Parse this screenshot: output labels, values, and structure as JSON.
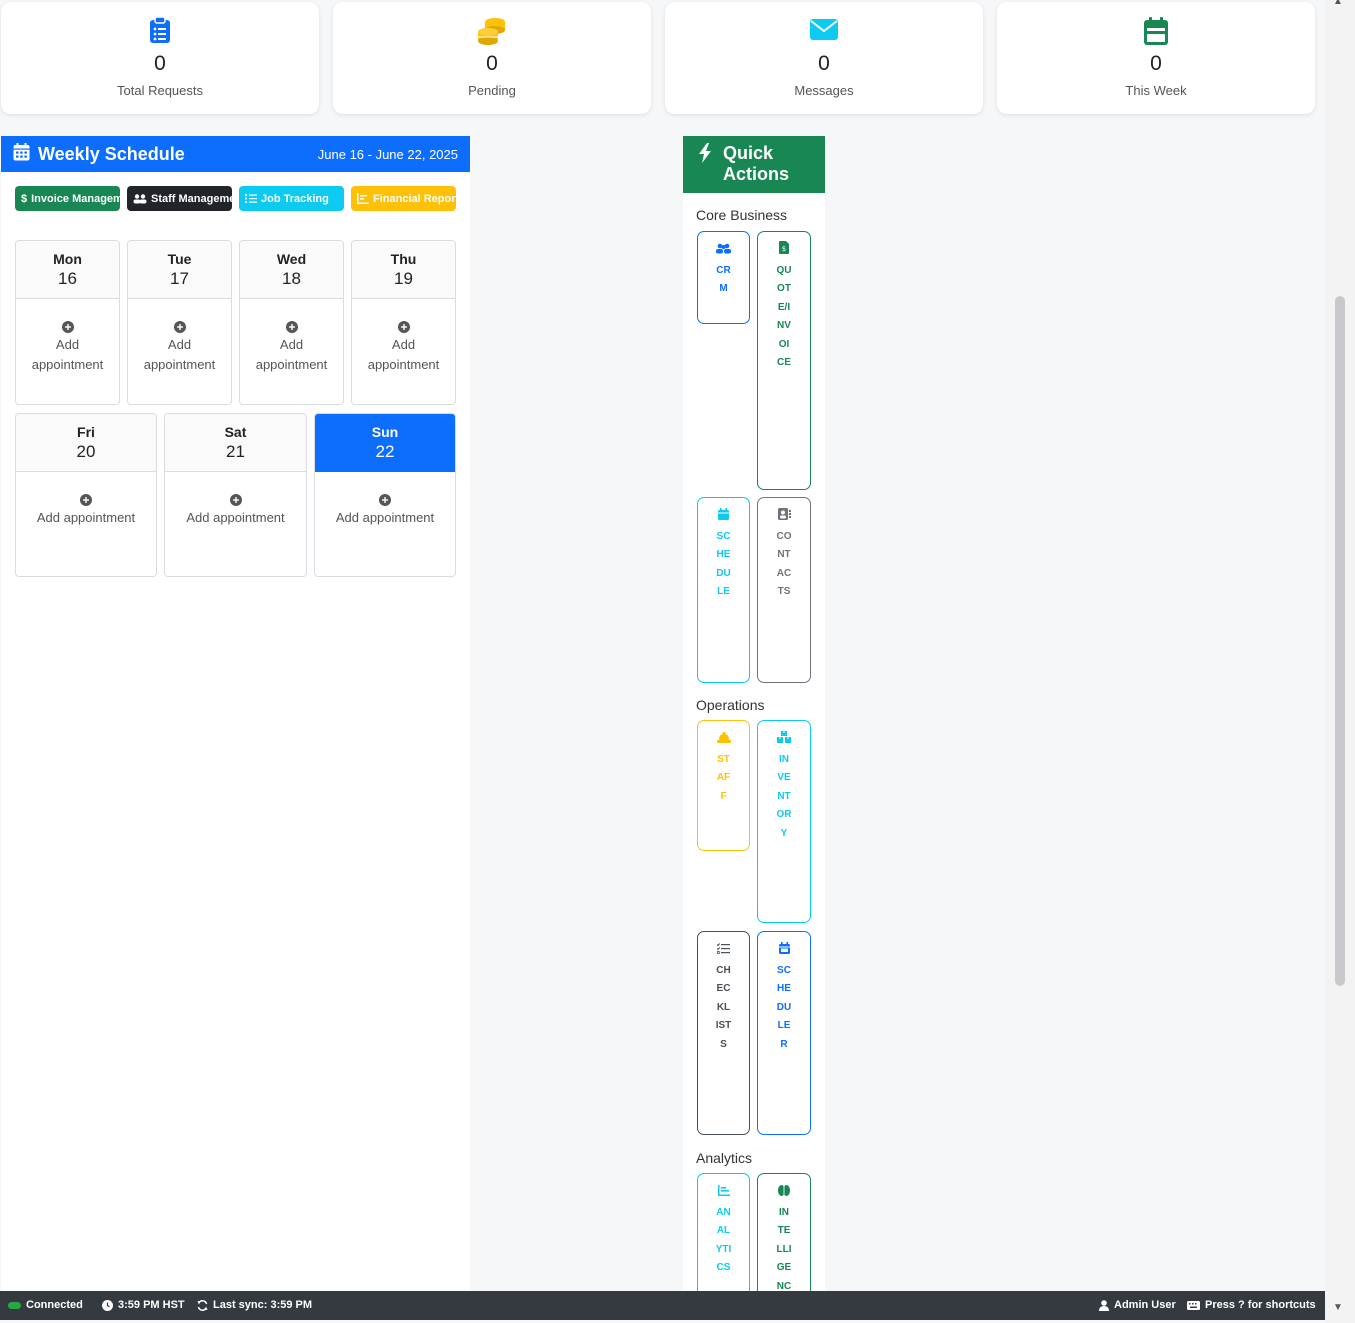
{
  "stats": [
    {
      "value": "0",
      "label": "Total Requests",
      "icon": "clipboard-list-icon",
      "color": "#0d6efd"
    },
    {
      "value": "0",
      "label": "Pending",
      "icon": "coins-icon",
      "color": "#ffc107"
    },
    {
      "value": "0",
      "label": "Messages",
      "icon": "envelope-icon",
      "color": "#0dcaf0"
    },
    {
      "value": "0",
      "label": "This Week",
      "icon": "calendar-icon",
      "color": "#198754"
    }
  ],
  "schedule": {
    "title": "Weekly Schedule",
    "range": "June 16 - June 22, 2025",
    "nav": [
      {
        "label": "Invoice Management",
        "color": "#198754",
        "icon": "dollar-icon"
      },
      {
        "label": "Staff Management",
        "color": "#212529",
        "icon": "users-icon"
      },
      {
        "label": "Job Tracking",
        "color": "#0dcaf0",
        "icon": "tasks-icon"
      },
      {
        "label": "Financial Reports",
        "color": "#ffc107",
        "icon": "chart-icon"
      }
    ],
    "add_label": "Add appointment",
    "days": [
      {
        "name": "Mon",
        "num": "16"
      },
      {
        "name": "Tue",
        "num": "17"
      },
      {
        "name": "Wed",
        "num": "18"
      },
      {
        "name": "Thu",
        "num": "19"
      },
      {
        "name": "Fri",
        "num": "20"
      },
      {
        "name": "Sat",
        "num": "21"
      },
      {
        "name": "Sun",
        "num": "22",
        "today": true
      }
    ]
  },
  "quick_actions": {
    "title": "Quick Actions",
    "sections": [
      {
        "title": "Core Business",
        "buttons": [
          {
            "label": "CRM",
            "color": "#0d6efd",
            "icon": "users-icon"
          },
          {
            "label": "QUOTE/INVOICE",
            "color": "#198754",
            "icon": "invoice-icon"
          },
          {
            "label": "SCHEDULE",
            "color": "#0dcaf0",
            "icon": "calendar-icon"
          },
          {
            "label": "CONTACTS",
            "color": "#6c757d",
            "icon": "address-book-icon"
          }
        ]
      },
      {
        "title": "Operations",
        "buttons": [
          {
            "label": "STAFF",
            "color": "#ffc107",
            "icon": "hard-hat-icon"
          },
          {
            "label": "INVENTORY",
            "color": "#0dcaf0",
            "icon": "boxes-icon"
          },
          {
            "label": "CHECKLISTS",
            "color": "#495057",
            "icon": "tasks-icon"
          },
          {
            "label": "SCHEDULER",
            "color": "#0d6efd",
            "icon": "calendar-icon"
          }
        ]
      },
      {
        "title": "Analytics",
        "buttons": [
          {
            "label": "ANALYTICS",
            "color": "#0dcaf0",
            "icon": "chart-icon"
          },
          {
            "label": "INTELLIGENCE",
            "color": "#198754",
            "icon": "brain-icon"
          }
        ]
      }
    ]
  },
  "status_bar": {
    "connection": "Connected",
    "time": "3:59 PM HST",
    "last_sync": "Last sync: 3:59 PM",
    "user": "Admin User",
    "shortcuts": "Press ? for shortcuts"
  }
}
